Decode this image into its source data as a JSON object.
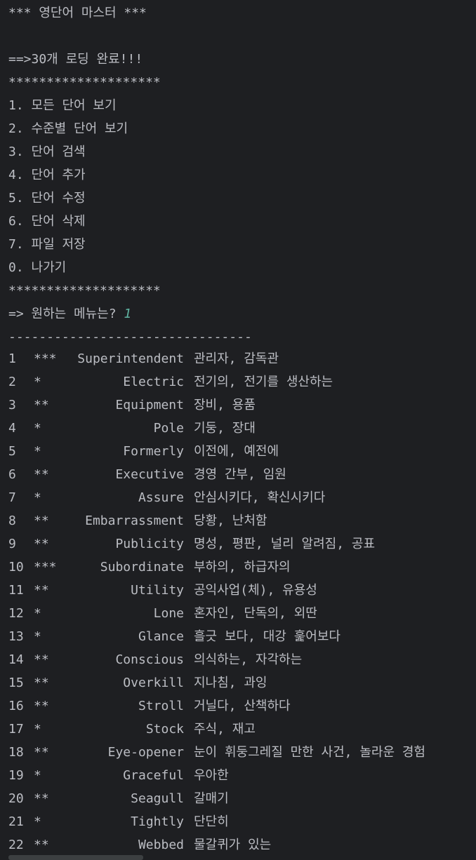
{
  "title": "*** 영단어 마스터 ***",
  "load_msg": "==>30개 로딩 완료!!!",
  "separator": "********************",
  "menu": [
    "1. 모든 단어 보기",
    "2. 수준별 단어 보기",
    "3. 단어 검색",
    "4. 단어 추가",
    "5. 단어 수정",
    "6. 단어 삭제",
    "7. 파일 저장",
    "0. 나가기"
  ],
  "prompt": "=> 원하는 메뉴는? ",
  "input_value": "1",
  "dash_line": "--------------------------------",
  "words": [
    {
      "no": "1",
      "level": "***",
      "word": "Superintendent",
      "meaning": "관리자, 감독관"
    },
    {
      "no": "2",
      "level": "*",
      "word": "Electric",
      "meaning": "전기의, 전기를 생산하는"
    },
    {
      "no": "3",
      "level": "**",
      "word": "Equipment",
      "meaning": "장비, 용품"
    },
    {
      "no": "4",
      "level": "*",
      "word": "Pole",
      "meaning": "기둥, 장대"
    },
    {
      "no": "5",
      "level": "*",
      "word": "Formerly",
      "meaning": "이전에, 예전에"
    },
    {
      "no": "6",
      "level": "**",
      "word": "Executive",
      "meaning": "경영 간부, 임원"
    },
    {
      "no": "7",
      "level": "*",
      "word": "Assure",
      "meaning": "안심시키다, 확신시키다"
    },
    {
      "no": "8",
      "level": "**",
      "word": "Embarrassment",
      "meaning": "당황, 난처함"
    },
    {
      "no": "9",
      "level": "**",
      "word": "Publicity",
      "meaning": "명성, 평판, 널리 알려짐, 공표"
    },
    {
      "no": "10",
      "level": "***",
      "word": "Subordinate",
      "meaning": "부하의, 하급자의"
    },
    {
      "no": "11",
      "level": "**",
      "word": "Utility",
      "meaning": "공익사업(체), 유용성"
    },
    {
      "no": "12",
      "level": "*",
      "word": "Lone",
      "meaning": "혼자인, 단독의, 외딴"
    },
    {
      "no": "13",
      "level": "*",
      "word": "Glance",
      "meaning": "흘긋 보다, 대강 훑어보다"
    },
    {
      "no": "14",
      "level": "**",
      "word": "Conscious",
      "meaning": "의식하는, 자각하는"
    },
    {
      "no": "15",
      "level": "**",
      "word": "Overkill",
      "meaning": "지나침, 과잉"
    },
    {
      "no": "16",
      "level": "**",
      "word": "Stroll",
      "meaning": "거닐다, 산책하다"
    },
    {
      "no": "17",
      "level": "*",
      "word": "Stock",
      "meaning": "주식, 재고"
    },
    {
      "no": "18",
      "level": "**",
      "word": "Eye-opener",
      "meaning": "눈이 휘둥그레질 만한 사건, 놀라운 경험"
    },
    {
      "no": "19",
      "level": "*",
      "word": "Graceful",
      "meaning": "우아한"
    },
    {
      "no": "20",
      "level": "**",
      "word": "Seagull",
      "meaning": "갈매기"
    },
    {
      "no": "21",
      "level": "*",
      "word": "Tightly",
      "meaning": "단단히"
    },
    {
      "no": "22",
      "level": "**",
      "word": "Webbed",
      "meaning": "물갈퀴가 있는"
    }
  ]
}
